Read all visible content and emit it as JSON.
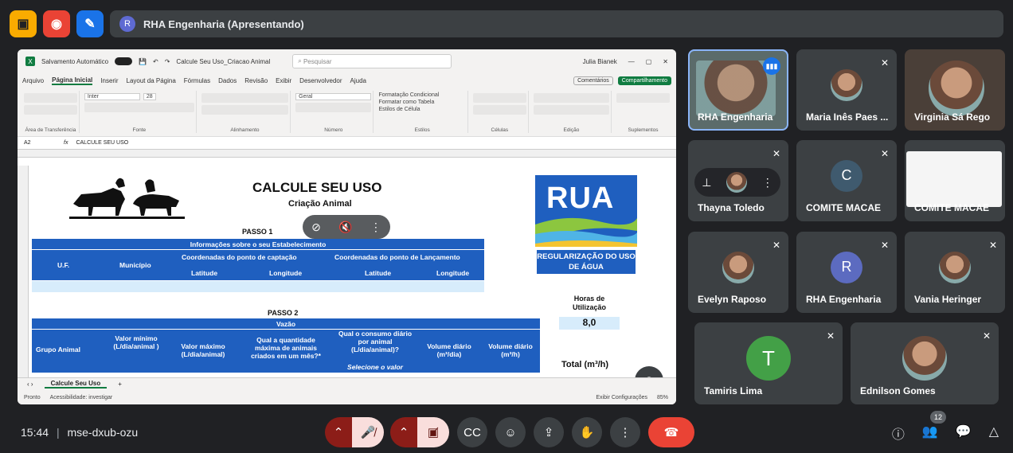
{
  "topbar": {
    "presenter_initial": "R",
    "presenting_title": "RHA Engenharia (Apresentando)"
  },
  "excel": {
    "autosave_label": "Salvamento Automático",
    "file_name": "Calcule Seu Uso_Criacao Animal",
    "search_placeholder": "Pesquisar",
    "user_name": "Julia Bianek",
    "menus": [
      "Arquivo",
      "Página Inicial",
      "Inserir",
      "Layout da Página",
      "Fórmulas",
      "Dados",
      "Revisão",
      "Exibir",
      "Desenvolvedor",
      "Ajuda"
    ],
    "comments_label": "Comentários",
    "share_label": "Compartilhamento",
    "ribbon_groups": [
      "Área de Transferência",
      "Fonte",
      "Alinhamento",
      "Número",
      "Estilos",
      "Células",
      "Edição",
      "Suplementos"
    ],
    "font_name": "Inter",
    "font_size": "28",
    "number_format": "Geral",
    "cond_format": "Formatação Condicional",
    "table_format": "Formatar como Tabela",
    "cell_styles": "Estilos de Célula",
    "name_box": "A2",
    "formula": "CALCULE SEU USO",
    "sheet": {
      "title": "CALCULE SEU USO",
      "subtitle": "Criação Animal",
      "passo1": "PASSO 1",
      "info_header": "Informações sobre o seu Estabelecimento",
      "uf": "U.F.",
      "municipio": "Município",
      "coord_captacao": "Coordenadas do ponto de captação",
      "coord_lancamento": "Coordenadas do ponto de Lançamento",
      "latitude": "Latitude",
      "longitude": "Longitude",
      "passo2": "PASSO 2",
      "vazao": "Vazão",
      "grupo_animal": "Grupo Animal",
      "valor_minimo": "Valor mínimo (L/dia/animal )",
      "valor_maximo": "Valor máximo (L/dia/animal)",
      "qtd_maxima": "Qual a quantidade máxima de animais criados em um mês?*",
      "consumo_diario": "Qual o consumo diário por animal (L/dia/animal)?",
      "selecione": "Selecione o valor",
      "volume_diario": "Volume diário (m³/dia)",
      "volume_diario_h": "Volume diário (m³/h)",
      "rua_logo": "RUA",
      "regularizacao": "REGULARIZAÇÃO DO USO DE ÁGUA",
      "horas_label": "Horas de Utilização",
      "horas_value": "8,0",
      "total_label": "Total (m³/h)"
    },
    "sheet_tab": "Calcule Seu Uso",
    "status_left": "Pronto",
    "accessibility": "Acessibilidade: investigar",
    "display_settings": "Exibir Configurações",
    "zoom_level": "85%"
  },
  "participants": [
    {
      "name": "RHA Engenharia",
      "type": "video"
    },
    {
      "name": "Maria Inês Paes ...",
      "type": "photo"
    },
    {
      "name": "Virginia Sá Rego",
      "type": "video"
    },
    {
      "name": "Thayna Toledo",
      "type": "photo"
    },
    {
      "name": "COMITE MACAE",
      "initial": "C",
      "color": "#3f5a6e"
    },
    {
      "name": "COMITE MACAE",
      "type": "screen"
    },
    {
      "name": "Evelyn Raposo",
      "type": "photo"
    },
    {
      "name": "RHA Engenharia",
      "initial": "R",
      "color": "#5c6bc0"
    },
    {
      "name": "Vania Heringer",
      "type": "photo"
    },
    {
      "name": "Tamiris Lima",
      "initial": "T",
      "color": "#43a047"
    },
    {
      "name": "Ednilson Gomes",
      "type": "photo"
    }
  ],
  "bottom": {
    "time": "15:44",
    "meeting_code": "mse-dxub-ozu",
    "participant_count": "12"
  },
  "colors": {
    "background": "#202124",
    "tile": "#3c4043",
    "end_call": "#ea4335",
    "sheet_blue": "#1f5fbf"
  }
}
